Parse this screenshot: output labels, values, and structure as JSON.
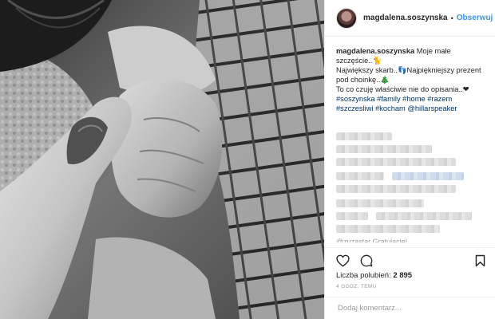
{
  "post": {
    "username": "magdalena.soszynska",
    "follow_label": "Obserwuj",
    "separator": "•",
    "caption": {
      "username": "magdalena.soszynska",
      "line1": "Moje małe szczęście..🐈",
      "line2": "Największy skarb..👣Najpiękniejszy prezent pod choinkę..🎄",
      "line3": "To co czuję właściwie nie do opisania..❤",
      "tags1": "#soszynska #family #home #razem",
      "tags2": "#szczesliwi #kocham @hillarspeaker"
    },
    "cut_comment": "@zuzastar Gratulacje!",
    "likes_label": "Liczba polubień:",
    "likes_count": "2 895",
    "time_ago": "4 GODZ. TEMU",
    "comment_placeholder": "Dodaj komentarz..."
  },
  "icons": {
    "like": "heart-icon",
    "comment": "comment-icon",
    "save": "bookmark-icon",
    "menu": "more-options-icon"
  },
  "colors": {
    "link": "#3897f0",
    "hashtag": "#003569",
    "text": "#262626",
    "muted": "#999999"
  }
}
